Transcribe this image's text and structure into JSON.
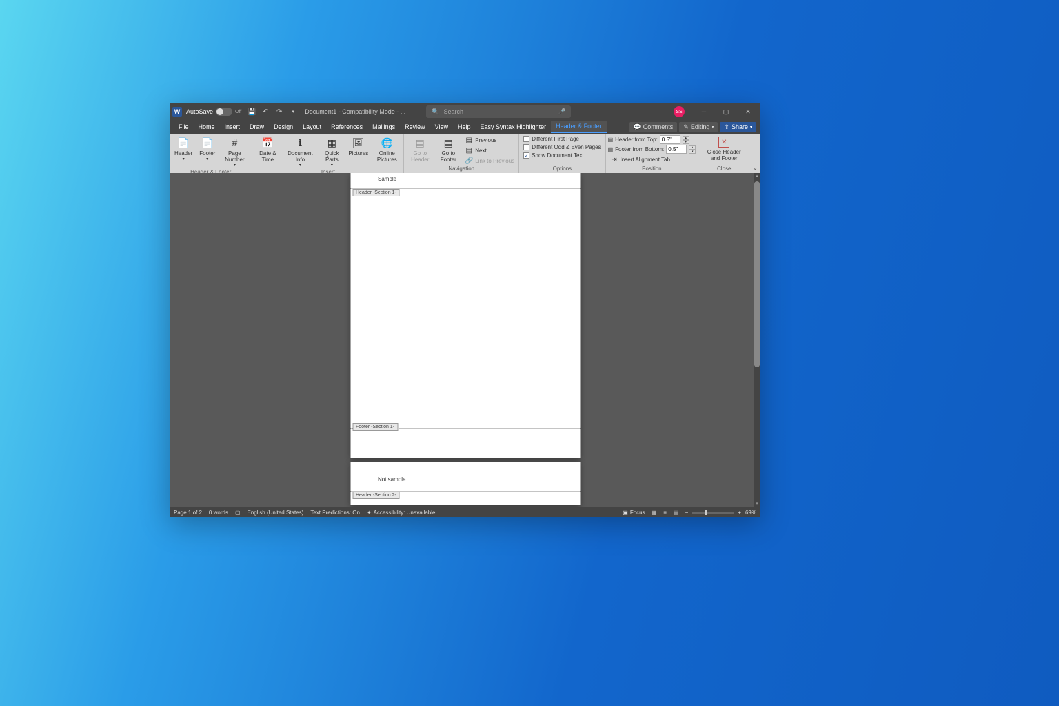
{
  "titlebar": {
    "autosave_label": "AutoSave",
    "autosave_state": "Off",
    "doc_title": "Document1 - Compatibility Mode - ...",
    "search_placeholder": "Search",
    "user_initials": "SS"
  },
  "tabs": {
    "items": [
      "File",
      "Home",
      "Insert",
      "Draw",
      "Design",
      "Layout",
      "References",
      "Mailings",
      "Review",
      "View",
      "Help",
      "Easy Syntax Highlighter",
      "Header & Footer"
    ],
    "active": "Header & Footer",
    "comments": "Comments",
    "editing": "Editing",
    "share": "Share"
  },
  "ribbon": {
    "g_hf": {
      "label": "Header & Footer",
      "header": "Header",
      "footer": "Footer",
      "page_number": "Page Number"
    },
    "g_insert": {
      "label": "Insert",
      "date_time": "Date & Time",
      "doc_info": "Document Info",
      "quick_parts": "Quick Parts",
      "pictures": "Pictures",
      "online_pictures": "Online Pictures"
    },
    "g_nav": {
      "label": "Navigation",
      "goto_header": "Go to Header",
      "goto_footer": "Go to Footer",
      "previous": "Previous",
      "next": "Next",
      "link_prev": "Link to Previous"
    },
    "g_options": {
      "label": "Options",
      "diff_first": "Different First Page",
      "diff_odd": "Different Odd & Even Pages",
      "show_doc": "Show Document Text"
    },
    "g_position": {
      "label": "Position",
      "from_top": "Header from Top:",
      "from_bottom": "Footer from Bottom:",
      "align_tab": "Insert Alignment Tab",
      "top_val": "0.5\"",
      "bottom_val": "0.5\""
    },
    "g_close": {
      "label": "Close",
      "close_btn": "Close Header and Footer"
    }
  },
  "document": {
    "page1_header_text": "Sample",
    "page1_header_label": "Header -Section 1-",
    "page1_footer_label": "Footer -Section 1-",
    "page2_header_text": "Not sample",
    "page2_header_label": "Header -Section 2-"
  },
  "statusbar": {
    "page": "Page 1 of 2",
    "words": "0 words",
    "language": "English (United States)",
    "predictions": "Text Predictions: On",
    "accessibility": "Accessibility: Unavailable",
    "focus": "Focus",
    "zoom": "69%"
  }
}
